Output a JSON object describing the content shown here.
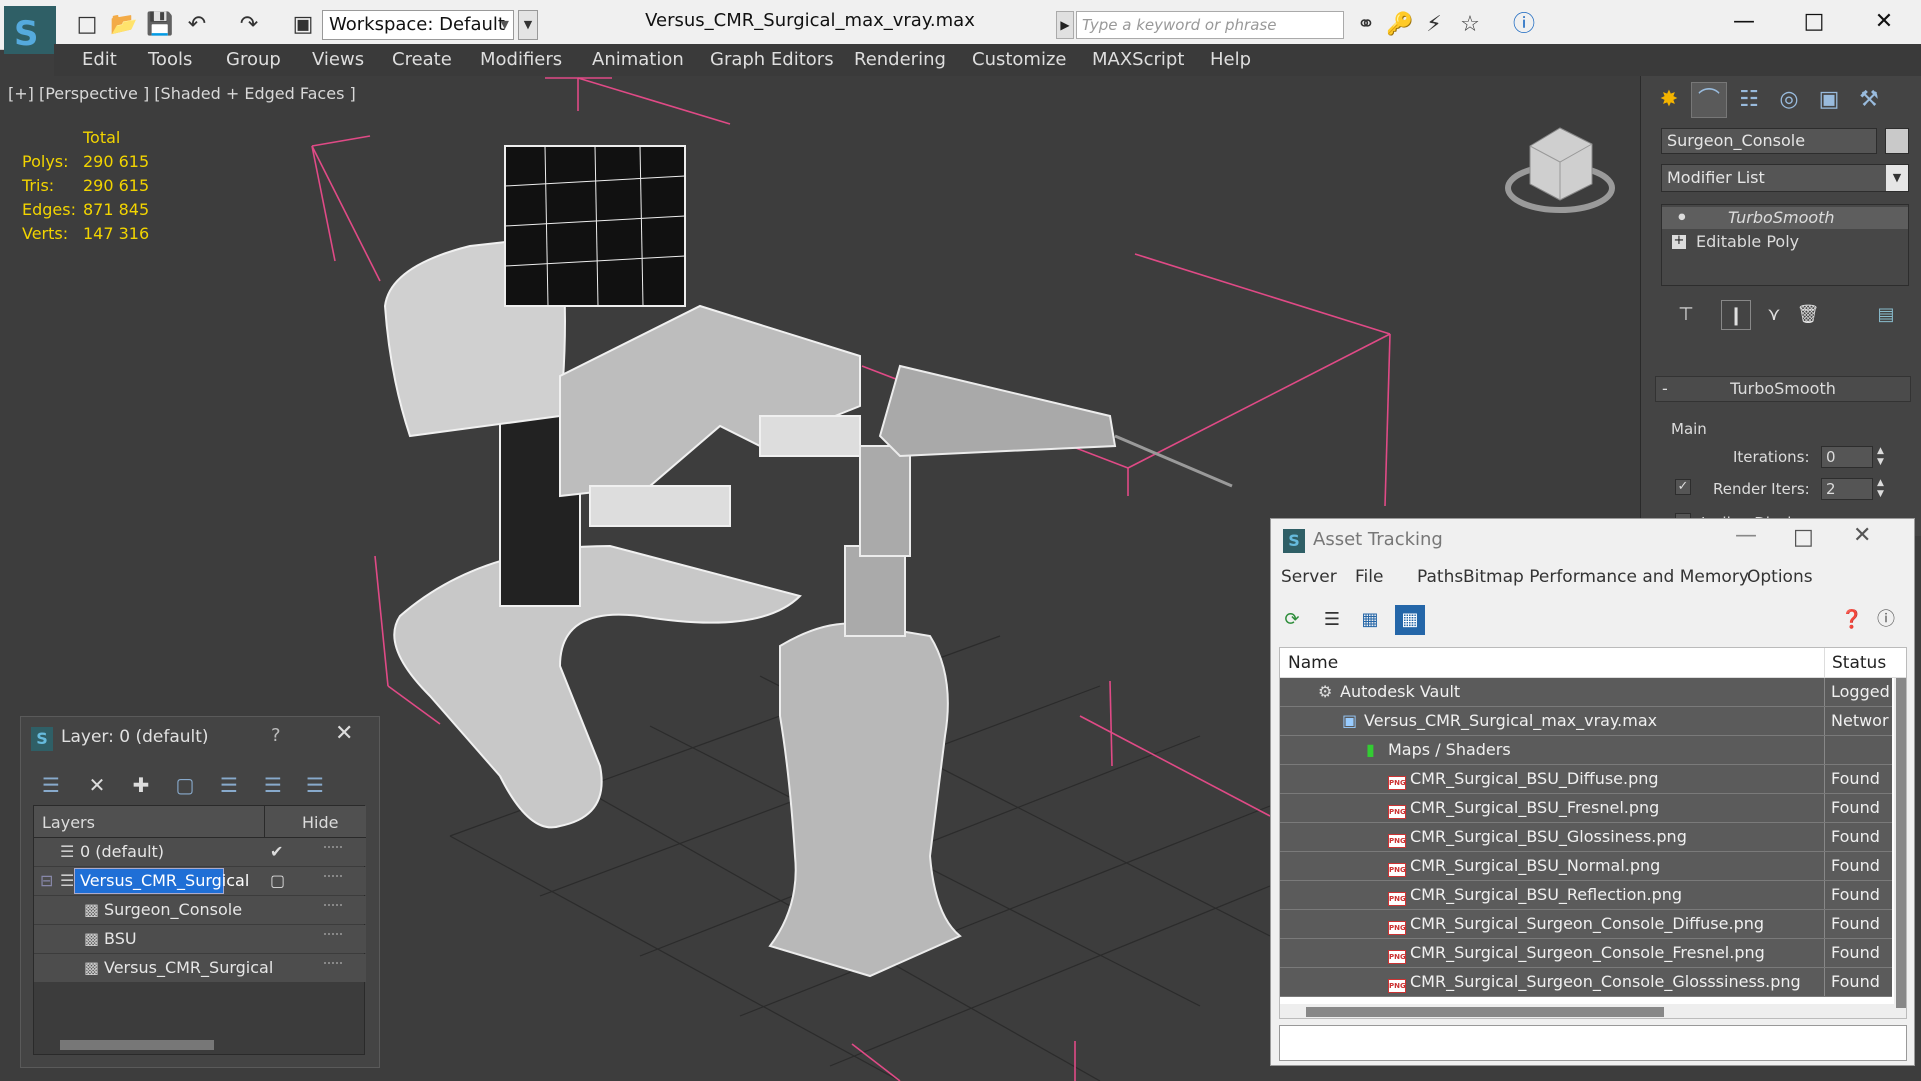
{
  "app": {
    "title": "Versus_CMR_Surgical_max_vray.max",
    "workspace": "Workspace: Default",
    "search_placeholder": "Type a keyword or phrase"
  },
  "menu": [
    "Edit",
    "Tools",
    "Group",
    "Views",
    "Create",
    "Modifiers",
    "Animation",
    "Graph Editors",
    "Rendering",
    "Customize",
    "MAXScript",
    "Help"
  ],
  "viewport": {
    "label": "[+] [Perspective ] [Shaded + Edged Faces ]",
    "stats": {
      "header": "Total",
      "rows": [
        {
          "label": "Polys:",
          "value": "290 615"
        },
        {
          "label": "Tris:",
          "value": "290 615"
        },
        {
          "label": "Edges:",
          "value": "871 845"
        },
        {
          "label": "Verts:",
          "value": "147 316"
        }
      ]
    }
  },
  "command_panel": {
    "object_name": "Surgeon_Console",
    "modifier_list": "Modifier List",
    "stack": [
      "TurboSmooth",
      "Editable Poly"
    ],
    "rollout_title": "TurboSmooth",
    "group_main": "Main",
    "iterations_label": "Iterations:",
    "iterations_value": "0",
    "render_iters_label": "Render Iters:",
    "render_iters_value": "2",
    "isoline_label": "Isoline Display"
  },
  "asset_tracking": {
    "title": "Asset Tracking",
    "menu": [
      "Server",
      "File",
      "Paths",
      "Bitmap Performance and Memory",
      "Options"
    ],
    "columns": {
      "name": "Name",
      "status": "Status"
    },
    "rows": [
      {
        "name": "Autodesk Vault",
        "status": "Logged",
        "indent": 0,
        "icon": "vault"
      },
      {
        "name": "Versus_CMR_Surgical_max_vray.max",
        "status": "Networ",
        "indent": 1,
        "icon": "max"
      },
      {
        "name": "Maps / Shaders",
        "status": "",
        "indent": 2,
        "icon": "folder"
      },
      {
        "name": "CMR_Surgical_BSU_Diffuse.png",
        "status": "Found",
        "indent": 3,
        "icon": "png"
      },
      {
        "name": "CMR_Surgical_BSU_Fresnel.png",
        "status": "Found",
        "indent": 3,
        "icon": "png"
      },
      {
        "name": "CMR_Surgical_BSU_Glossiness.png",
        "status": "Found",
        "indent": 3,
        "icon": "png"
      },
      {
        "name": "CMR_Surgical_BSU_Normal.png",
        "status": "Found",
        "indent": 3,
        "icon": "png"
      },
      {
        "name": "CMR_Surgical_BSU_Reflection.png",
        "status": "Found",
        "indent": 3,
        "icon": "png"
      },
      {
        "name": "CMR_Surgical_Surgeon_Console_Diffuse.png",
        "status": "Found",
        "indent": 3,
        "icon": "png"
      },
      {
        "name": "CMR_Surgical_Surgeon_Console_Fresnel.png",
        "status": "Found",
        "indent": 3,
        "icon": "png"
      },
      {
        "name": "CMR_Surgical_Surgeon_Console_Glosssiness.png",
        "status": "Found",
        "indent": 3,
        "icon": "png"
      }
    ]
  },
  "layer_window": {
    "title": "Layer: 0 (default)",
    "help": "?",
    "columns": {
      "layers": "Layers",
      "hide": "Hide"
    },
    "rows": [
      {
        "name": "0 (default)",
        "indent": 1,
        "selected": false,
        "icon": "layer"
      },
      {
        "name": "Versus_CMR_Surgical",
        "indent": 1,
        "selected": true,
        "icon": "layer"
      },
      {
        "name": "Surgeon_Console",
        "indent": 2,
        "selected": false,
        "icon": "object"
      },
      {
        "name": "BSU",
        "indent": 2,
        "selected": false,
        "icon": "object"
      },
      {
        "name": "Versus_CMR_Surgical",
        "indent": 2,
        "selected": false,
        "icon": "object"
      }
    ]
  },
  "colors": {
    "selection": "#1f6fd6",
    "stats_yellow": "#f2d400",
    "bbox_pink": "#e04a86",
    "grid": "#2a2a2a"
  }
}
